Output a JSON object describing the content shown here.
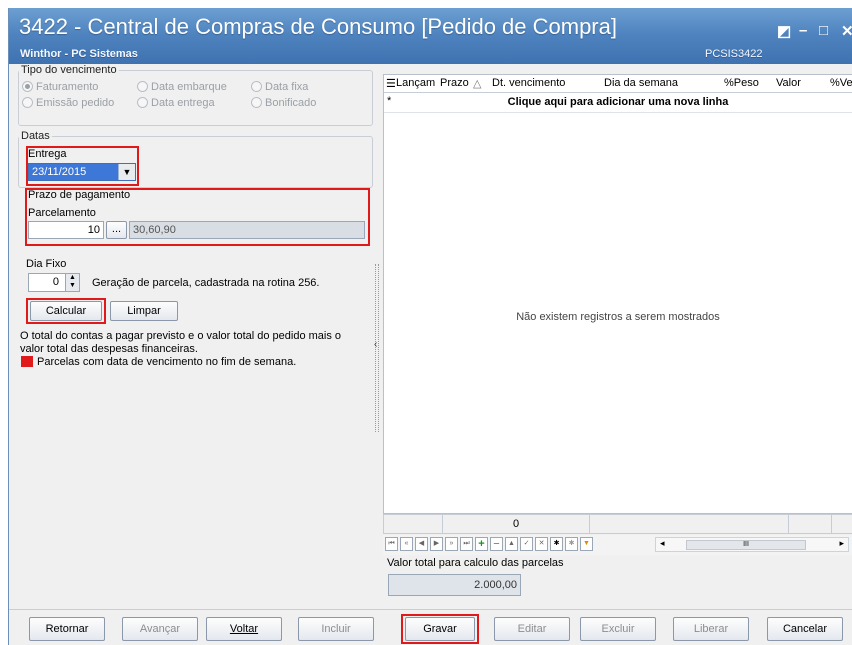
{
  "window": {
    "title": "3422 - Central de Compras de Consumo [Pedido de Compra]",
    "subtitle": "Winthor - PC Sistemas",
    "code": "PCSIS3422",
    "controls": {
      "restore": "◩",
      "minimize": "–",
      "maximize": "□",
      "close": "✕"
    }
  },
  "vencimento": {
    "legend": "Tipo do vencimento",
    "options": [
      {
        "label": "Faturamento",
        "selected": true
      },
      {
        "label": "Data embarque",
        "selected": false
      },
      {
        "label": "Data fixa",
        "selected": false
      },
      {
        "label": "Emissão pedido",
        "selected": false
      },
      {
        "label": "Data entrega",
        "selected": false
      },
      {
        "label": "Bonificado",
        "selected": false
      }
    ]
  },
  "datas": {
    "legend": "Datas",
    "entrega_label": "Entrega",
    "entrega_value": "23/11/2015"
  },
  "prazo": {
    "legend": "Prazo de pagamento",
    "parcelamento_label": "Parcelamento",
    "parcelas": "10",
    "ellipsis": "...",
    "prazos": "30,60,90"
  },
  "diafixo": {
    "label": "Dia Fixo",
    "value": "0",
    "note": "Geração de parcela, cadastrada na rotina 256."
  },
  "actions": {
    "calcular": "Calcular",
    "limpar": "Limpar"
  },
  "info": {
    "line1": "O total do contas a pagar previsto e o valor total do pedido mais o",
    "line2": "valor total das despesas financeiras.",
    "legend": "Parcelas com data de vencimento no fim de semana.",
    "legend_color": "#e0191b"
  },
  "grid": {
    "columns": [
      "Lançam",
      "Prazo",
      "Dt. vencimento",
      "Dia da semana",
      "%Peso",
      "Valor",
      "%Ve"
    ],
    "new_row": "Clique aqui para adicionar uma nova linha",
    "empty": "Não existem registros a serem mostrados",
    "sum_value": "0"
  },
  "total": {
    "label": "Valor total para calculo das parcelas",
    "value": "2.000,00"
  },
  "footer": {
    "retornar": "Retornar",
    "avancar": "Avançar",
    "voltar": "Voltar",
    "incluir": "Incluir",
    "gravar": "Gravar",
    "editar": "Editar",
    "excluir": "Excluir",
    "liberar": "Liberar",
    "cancelar": "Cancelar"
  },
  "colors": {
    "accent_red": "#e0191b",
    "title_blue": "#4f84c0",
    "selection_blue": "#3d78d8"
  }
}
